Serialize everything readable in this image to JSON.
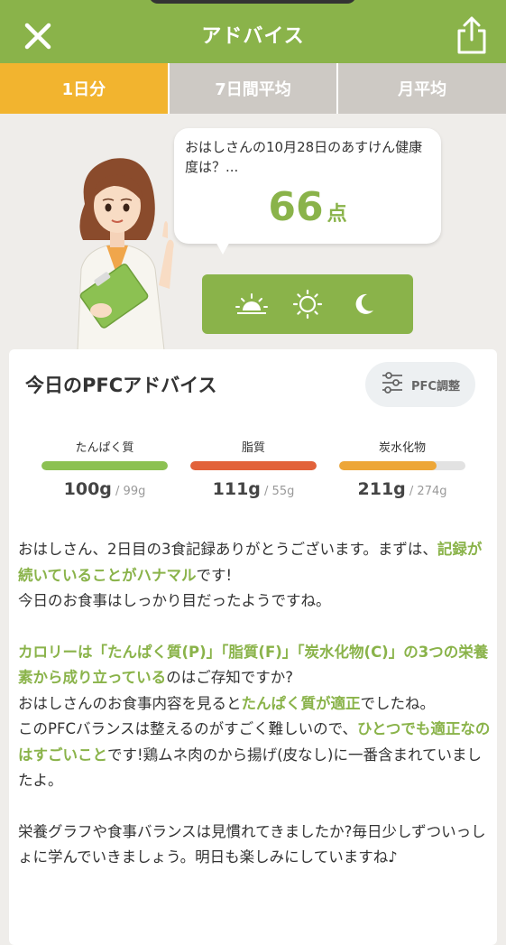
{
  "header": {
    "title": "アドバイス",
    "close_icon": "close-icon",
    "share_icon": "share-icon"
  },
  "tabs": [
    {
      "label": "1日分",
      "active": true
    },
    {
      "label": "7日間平均",
      "active": false
    },
    {
      "label": "月平均",
      "active": false
    }
  ],
  "bubble": {
    "text": "おはしさんの10月28日のあすけん健康度は？...",
    "score": "66",
    "unit": "点"
  },
  "time_icons": [
    "sunrise-icon",
    "sun-icon",
    "moon-icon"
  ],
  "card": {
    "title": "今日のPFCアドバイス",
    "pfc_button": "PFC調整",
    "nutrients": [
      {
        "name": "たんぱく質",
        "intake": "100g",
        "target": "/ 99g",
        "ratio": 1.0,
        "color": "#8cc152"
      },
      {
        "name": "脂質",
        "intake": "111g",
        "target": "/ 55g",
        "ratio": 1.0,
        "color": "#e2623a"
      },
      {
        "name": "炭水化物",
        "intake": "211g",
        "target": "/ 274g",
        "ratio": 0.77,
        "color": "#eda637"
      }
    ],
    "advice": {
      "p1": {
        "a": "おはしさん、2日目の3食記録ありがとうございます。まずは、",
        "b": "記録が続いていることがハナマル",
        "c": "です!"
      },
      "p2": "今日のお食事はしっかり目だったようですね。",
      "p3": {
        "a": "カロリーは「たんぱく質(P)」「脂質(F)」「炭水化物(C)」の3つの栄養素から成り立っている",
        "b": "のはご存知ですか?"
      },
      "p4": {
        "a": "おはしさんのお食事内容を見ると",
        "b": "たんぱく質が適正",
        "c": "でしたね。"
      },
      "p5": {
        "a": "このPFCバランスは整えるのがすごく難しいので、",
        "b": "ひとつでも適正なのはすごいこと",
        "c": "です!鶏ムネ肉のから揚げ(皮なし)に一番含まれていましたよ。"
      },
      "p6": "栄養グラフや食事バランスは見慣れてきましたか?毎日少しずついっしょに学んでいきましょう。明日も楽しみにしていますね♪"
    }
  },
  "colors": {
    "brand_green": "#8ab34a",
    "tab_active": "#f2b42f",
    "tab_inactive": "#cdc9c4",
    "background": "#efedea"
  }
}
